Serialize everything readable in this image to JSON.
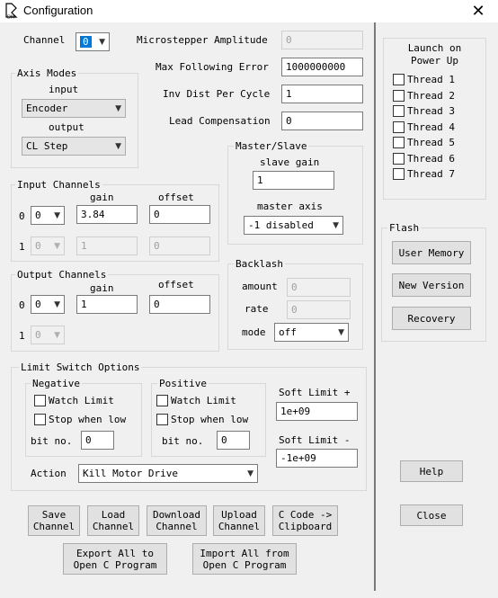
{
  "window": {
    "title": "Configuration",
    "close_glyph": "✕",
    "icon_text": "DM"
  },
  "channel": {
    "label": "Channel",
    "value": "0"
  },
  "fields": {
    "microstepper_amplitude": {
      "label": "Microstepper Amplitude",
      "value": "0"
    },
    "max_following_error": {
      "label": "Max Following Error",
      "value": "1000000000"
    },
    "inv_dist_per_cycle": {
      "label": "Inv Dist Per Cycle",
      "value": "1"
    },
    "lead_compensation": {
      "label": "Lead Compensation",
      "value": "0"
    }
  },
  "axis_modes": {
    "title": "Axis Modes",
    "input_label": "input",
    "input_value": "Encoder",
    "output_label": "output",
    "output_value": "CL Step"
  },
  "master_slave": {
    "title": "Master/Slave",
    "slave_gain_label": "slave gain",
    "slave_gain_value": "1",
    "master_axis_label": "master axis",
    "master_axis_value": "-1 disabled"
  },
  "input_channels": {
    "title": "Input Channels",
    "gain_header": "gain",
    "offset_header": "offset",
    "rows": [
      {
        "index": "0",
        "channel": "0",
        "gain": "3.84",
        "offset": "0"
      },
      {
        "index": "1",
        "channel": "0",
        "gain": "1",
        "offset": "0"
      }
    ]
  },
  "output_channels": {
    "title": "Output Channels",
    "gain_header": "gain",
    "offset_header": "offset",
    "rows": [
      {
        "index": "0",
        "channel": "0",
        "gain": "1",
        "offset": "0"
      },
      {
        "index": "1",
        "channel": "0"
      }
    ]
  },
  "backlash": {
    "title": "Backlash",
    "amount_label": "amount",
    "amount_value": "0",
    "rate_label": "rate",
    "rate_value": "0",
    "mode_label": "mode",
    "mode_value": "off"
  },
  "limit_switch": {
    "title": "Limit Switch Options",
    "negative": {
      "title": "Negative",
      "watch_limit": "Watch Limit",
      "stop_when_low": "Stop when low",
      "bit_no_label": "bit no.",
      "bit_no_value": "0"
    },
    "positive": {
      "title": "Positive",
      "watch_limit": "Watch Limit",
      "stop_when_low": "Stop when low",
      "bit_no_label": "bit no.",
      "bit_no_value": "0"
    },
    "soft_limit_plus_label": "Soft Limit +",
    "soft_limit_plus_value": "1e+09",
    "soft_limit_minus_label": "Soft Limit -",
    "soft_limit_minus_value": "-1e+09",
    "action_label": "Action",
    "action_value": "Kill Motor Drive"
  },
  "buttons": {
    "save_channel": "Save\nChannel",
    "load_channel": "Load\nChannel",
    "download_channel": "Download\nChannel",
    "upload_channel": "Upload\nChannel",
    "c_code_clipboard": "C Code ->\nClipboard",
    "export_all": "Export All to\nOpen C Program",
    "import_all": "Import All from\nOpen C Program",
    "help": "Help",
    "close": "Close"
  },
  "launch": {
    "title": "Launch on\nPower Up",
    "threads": [
      "Thread 1",
      "Thread 2",
      "Thread 3",
      "Thread 4",
      "Thread 5",
      "Thread 6",
      "Thread 7"
    ]
  },
  "flash": {
    "title": "Flash",
    "user_memory": "User Memory",
    "new_version": "New Version",
    "recovery": "Recovery"
  }
}
